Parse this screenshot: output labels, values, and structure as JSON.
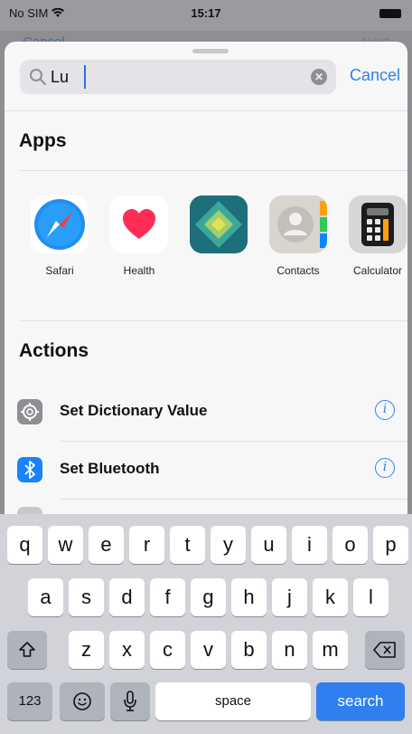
{
  "status_bar": {
    "carrier": "No SIM",
    "time": "15:17"
  },
  "behind": {
    "left": "Cancel",
    "right": "Next"
  },
  "search": {
    "query": "Lu",
    "cancel": "Cancel"
  },
  "apps_section": {
    "title": "Apps",
    "items": [
      {
        "label": "Safari",
        "icon": "safari-icon"
      },
      {
        "label": "Health",
        "icon": "health-heart-icon"
      },
      {
        "label": "",
        "icon": "teal-diamond-app-icon"
      },
      {
        "label": "Contacts",
        "icon": "contacts-icon"
      },
      {
        "label": "Calculator",
        "icon": "calculator-icon"
      }
    ]
  },
  "actions_section": {
    "title": "Actions",
    "items": [
      {
        "label": "Set Dictionary Value",
        "icon": "gear-icon",
        "color": "#8e8e93"
      },
      {
        "label": "Set Bluetooth",
        "icon": "bluetooth-icon",
        "color": "#1a82fb"
      }
    ]
  },
  "keyboard": {
    "row1": [
      "q",
      "w",
      "e",
      "r",
      "t",
      "y",
      "u",
      "i",
      "o",
      "p"
    ],
    "row2": [
      "a",
      "s",
      "d",
      "f",
      "g",
      "h",
      "j",
      "k",
      "l"
    ],
    "row3": [
      "z",
      "x",
      "c",
      "v",
      "b",
      "n",
      "m"
    ],
    "numbers": "123",
    "space": "space",
    "search": "search"
  },
  "colors": {
    "accent": "#2f7ff0",
    "sheet": "#f7f7f8",
    "keyboard": "#d1d3d9"
  }
}
